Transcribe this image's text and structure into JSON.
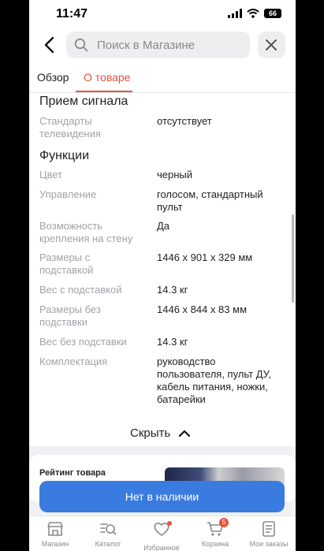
{
  "status_bar": {
    "time": "11:47",
    "battery": "66"
  },
  "header": {
    "search_placeholder": "Поиск в Магазине"
  },
  "tabs": [
    {
      "label": "Обзор",
      "active": false
    },
    {
      "label": "О товаре",
      "active": true
    }
  ],
  "sections": {
    "reception": {
      "title": "Прием сигнала",
      "specs": [
        {
          "key": "Стандарты телевидения",
          "value": "отсутствует"
        }
      ]
    },
    "functions": {
      "title": "Функции",
      "specs": [
        {
          "key": "Цвет",
          "value": "черный"
        },
        {
          "key": "Управление",
          "value": "голосом, стандартный пульт"
        },
        {
          "key": "Возможность крепления на стену",
          "value": "Да"
        },
        {
          "key": "Размеры с подставкой",
          "value": "1446 x 901 x 329 мм"
        },
        {
          "key": "Вес с подставкой",
          "value": "14.3 кг"
        },
        {
          "key": "Размеры без подставки",
          "value": "1446 x 844 x 83 мм"
        },
        {
          "key": "Вес без подставки",
          "value": "14.3 кг"
        },
        {
          "key": "Комплектация",
          "value": "руководство пользователя, пульт ДУ, кабель питания, ножки, батарейки"
        }
      ]
    }
  },
  "collapse_label": "Скрыть",
  "rating_label": "Рейтинг товара",
  "buy_button_label": "Нет в наличии",
  "bottom_nav": [
    {
      "label": "Магазин",
      "icon": "store-icon"
    },
    {
      "label": "Каталог",
      "icon": "catalog-search-icon"
    },
    {
      "label": "Избранное",
      "icon": "heart-icon"
    },
    {
      "label": "Корзина",
      "icon": "cart-icon",
      "badge": "5"
    },
    {
      "label": "Мои заказы",
      "icon": "orders-icon"
    }
  ],
  "colors": {
    "accent": "#e0553a",
    "button": "#3a7be0",
    "badge": "#e2553b"
  }
}
